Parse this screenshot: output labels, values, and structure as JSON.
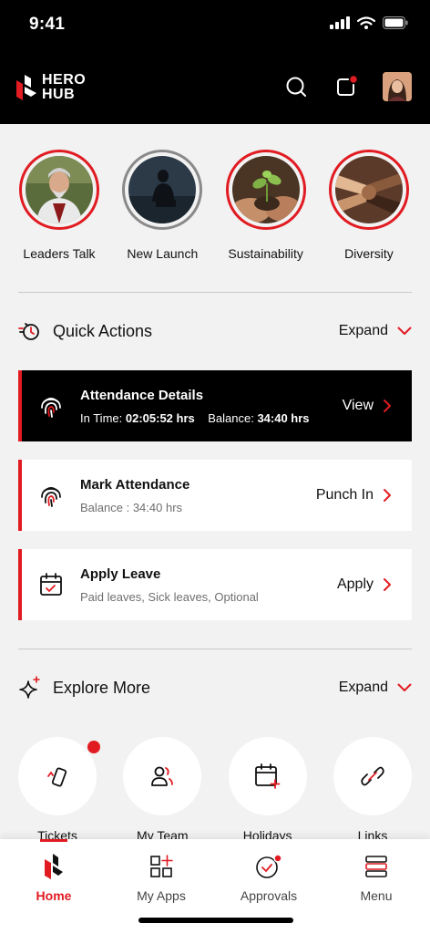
{
  "status": {
    "time": "9:41"
  },
  "header": {
    "logo_line1": "HERO",
    "logo_line2": "HUB"
  },
  "stories": [
    {
      "label": "Leaders Talk"
    },
    {
      "label": "New Launch"
    },
    {
      "label": "Sustainability"
    },
    {
      "label": "Diversity"
    }
  ],
  "quick_actions": {
    "title": "Quick Actions",
    "expand_label": "Expand",
    "attendance_details": {
      "title": "Attendance Details",
      "in_time_label": "In Time:",
      "in_time_value": "02:05:52 hrs",
      "balance_label": "Balance:",
      "balance_value": "34:40 hrs",
      "cta": "View"
    },
    "mark_attendance": {
      "title": "Mark Attendance",
      "subtitle": "Balance : 34:40 hrs",
      "cta": "Punch In"
    },
    "apply_leave": {
      "title": "Apply Leave",
      "subtitle": "Paid leaves, Sick leaves, Optional",
      "cta": "Apply"
    }
  },
  "explore_more": {
    "title": "Explore More",
    "expand_label": "Expand",
    "items": [
      {
        "label": "Tickets",
        "icon": "ticket-icon"
      },
      {
        "label": "My Team",
        "icon": "team-icon"
      },
      {
        "label": "Holidays",
        "icon": "calendar-add-icon"
      },
      {
        "label": "Links",
        "icon": "link-icon"
      }
    ]
  },
  "bottom_nav": [
    {
      "label": "Home",
      "icon": "home-logo-icon",
      "active": true
    },
    {
      "label": "My Apps",
      "icon": "apps-grid-icon"
    },
    {
      "label": "Approvals",
      "icon": "approval-check-icon"
    },
    {
      "label": "Menu",
      "icon": "menu-icon"
    }
  ],
  "colors": {
    "accent": "#e11b22",
    "header_bg": "#000000",
    "page_bg": "#f2f2f2"
  }
}
